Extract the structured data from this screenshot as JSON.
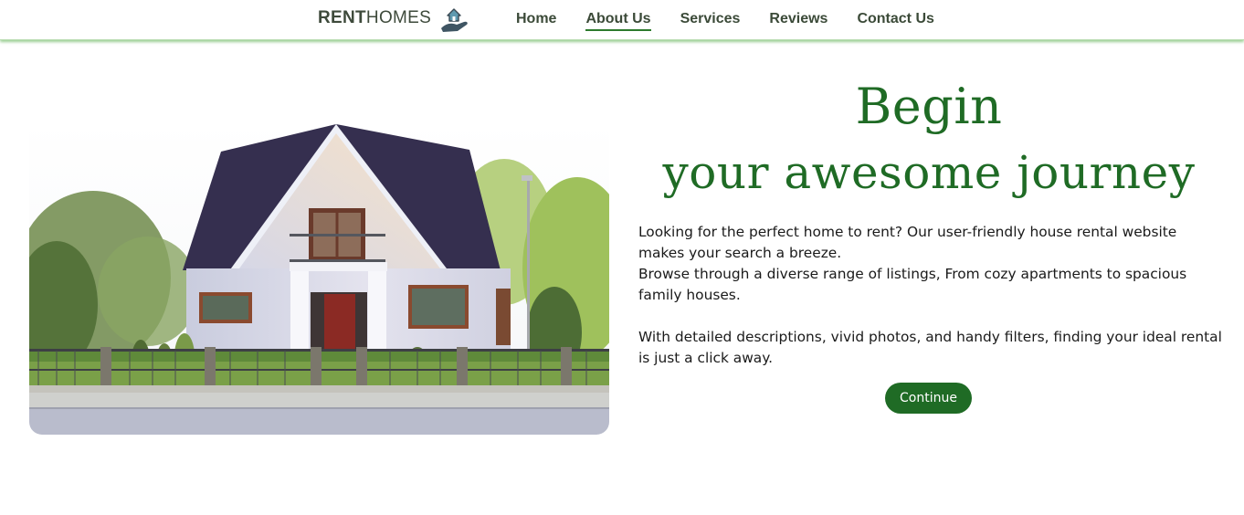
{
  "brand": {
    "name_bold": "RENT",
    "name_light": "HOMES",
    "icon": "house-in-hand-icon"
  },
  "nav": {
    "items": [
      {
        "label": "Home",
        "active": false
      },
      {
        "label": "About Us",
        "active": true
      },
      {
        "label": "Services",
        "active": false
      },
      {
        "label": "Reviews",
        "active": false
      },
      {
        "label": "Contact Us",
        "active": false
      }
    ]
  },
  "hero": {
    "title_line1": "Begin",
    "title_line2": "your awesome journey",
    "paragraph1": "Looking for the perfect home to rent? Our user-friendly house rental website makes your search a breeze.",
    "paragraph2": "Browse through a diverse range of listings, From cozy apartments to spacious family houses.",
    "paragraph3": "With detailed descriptions, vivid photos, and handy filters, finding your ideal rental is just a click away.",
    "button_label": "Continue",
    "image": "white-house-photo"
  },
  "colors": {
    "accent_green": "#1f6b25",
    "nav_text": "#3b4a38",
    "nav_underline": "#2d7a2d",
    "nav_shadow": "#8cc77f"
  }
}
